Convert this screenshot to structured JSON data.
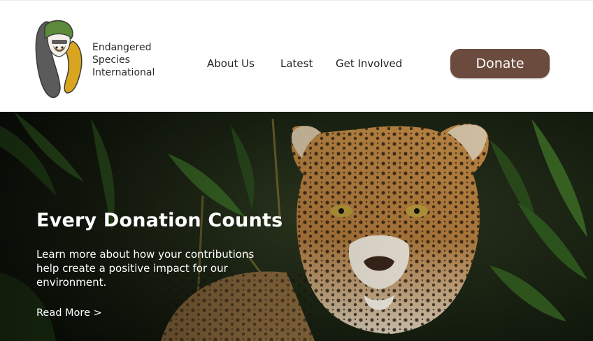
{
  "header": {
    "org_name_lines": [
      "Endangered",
      "Species",
      "International"
    ],
    "nav": [
      {
        "label": "About Us"
      },
      {
        "label": "Latest"
      },
      {
        "label": "Get Involved"
      }
    ],
    "donate_label": "Donate"
  },
  "hero": {
    "title": "Every Donation Counts",
    "description": "Learn more about how your contributions help create a positive impact for our environment.",
    "read_more_label": "Read More >",
    "image_subject": "jaguar-in-jungle"
  },
  "colors": {
    "brand_brown": "#6b4b3e",
    "logo_green": "#5a8a3a",
    "logo_gold": "#d9a520",
    "logo_gray": "#5b5b5b"
  }
}
